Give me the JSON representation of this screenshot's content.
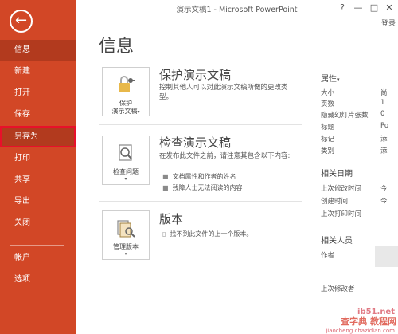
{
  "window": {
    "title": "演示文稿1 - Microsoft PowerPoint",
    "help": "?",
    "minimize": "—",
    "restore": "□",
    "close": "✕",
    "login": "登录"
  },
  "sidebar": {
    "back_glyph": "←",
    "items": [
      {
        "label": "信息",
        "active": true
      },
      {
        "label": "新建"
      },
      {
        "label": "打开"
      },
      {
        "label": "保存"
      },
      {
        "label": "另存为",
        "highlighted": true
      },
      {
        "label": "打印"
      },
      {
        "label": "共享"
      },
      {
        "label": "导出"
      },
      {
        "label": "关闭"
      },
      {
        "label": "帐户"
      },
      {
        "label": "选项"
      }
    ]
  },
  "main": {
    "title": "信息",
    "protect": {
      "icon": "lock-key-icon",
      "button_line1": "保护",
      "button_line2": "演示文稿",
      "caret": "▾",
      "title": "保护演示文稿",
      "desc": "控制其他人可以对此演示文稿所做的更改类型。"
    },
    "inspect": {
      "icon": "check-issues-icon",
      "button_label": "检查问题",
      "caret": "▾",
      "title": "检查演示文稿",
      "desc": "在发布此文件之前，请注意其包含以下内容:",
      "bullets": [
        "文档属性和作者的姓名",
        "残障人士无法阅读的内容"
      ]
    },
    "versions": {
      "icon": "manage-versions-icon",
      "button_label": "管理版本",
      "caret": "▾",
      "title": "版本",
      "desc": "找不到此文件的上一个版本。"
    }
  },
  "properties": {
    "header": "属性",
    "header_caret": "▾",
    "rows": [
      {
        "label": "大小",
        "value": "尚"
      },
      {
        "label": "页数",
        "value": "1"
      },
      {
        "label": "隐藏幻灯片张数",
        "value": "0"
      },
      {
        "label": "标题",
        "value": "Po"
      },
      {
        "label": "标记",
        "value": "添"
      },
      {
        "label": "类别",
        "value": "添"
      }
    ],
    "dates_header": "相关日期",
    "dates": [
      {
        "label": "上次修改时间",
        "value": "今"
      },
      {
        "label": "创建时间",
        "value": "今"
      },
      {
        "label": "上次打印时间",
        "value": ""
      }
    ],
    "people_header": "相关人员",
    "people": [
      {
        "label": "作者",
        "value": ""
      }
    ],
    "last_modified_by": "上次修改者"
  },
  "watermark": {
    "text": "查字典 教程网",
    "url": "jiaocheng.chazidian.com",
    "site": "ib51.net"
  },
  "colors": {
    "sidebar": "#d24726",
    "sidebar_active": "#b23a1e",
    "highlight_border": "#e8102a"
  }
}
